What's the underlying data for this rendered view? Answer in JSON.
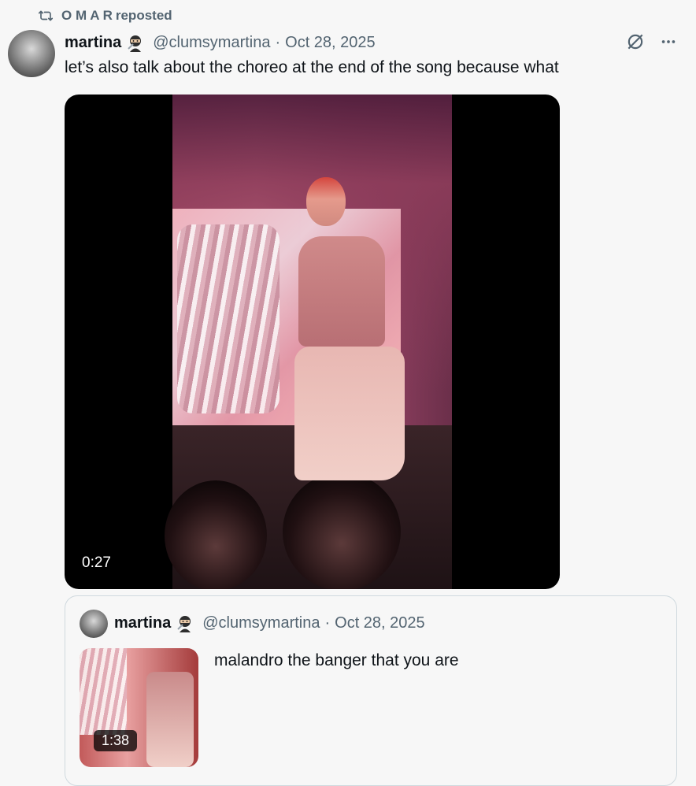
{
  "repost": {
    "user": "O M A R",
    "label": "reposted"
  },
  "tweet": {
    "name": "martina",
    "handle": "@clumsymartina",
    "separator": "·",
    "date": "Oct 28, 2025",
    "text": "let’s also talk about the choreo at the end of the song because what",
    "video_duration": "0:27"
  },
  "quoted": {
    "name": "martina",
    "handle": "@clumsymartina",
    "separator": "·",
    "date": "Oct 28, 2025",
    "text": "malandro the banger that you are",
    "video_duration": "1:38"
  },
  "icons": {
    "repost": "repost-icon",
    "grok": "grok-icon",
    "more": "more-icon",
    "ninja": "ninja-emoji-icon"
  },
  "colors": {
    "secondary_text": "#536471",
    "border": "#cfd9de",
    "background": "#f7f7f7"
  }
}
